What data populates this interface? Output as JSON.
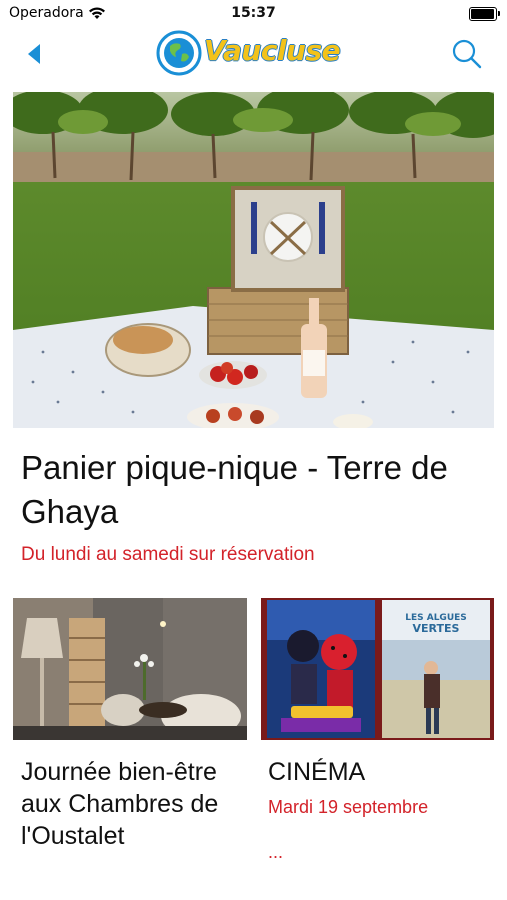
{
  "status_bar": {
    "carrier": "Operadora",
    "time": "15:37",
    "battery_level": 0.9
  },
  "nav": {
    "brand": "Vaucluse",
    "back_icon": "chevron-left-icon",
    "search_icon": "search-icon",
    "accent_color": "#1a8fd6",
    "brand_color": "#f3c21a"
  },
  "featured": {
    "title": "Panier pique-nique - Terre de Ghaya",
    "subtitle": "Du lundi au samedi sur réservation"
  },
  "cards": [
    {
      "title": "Journée bien-être aux Chambres de l'Oustalet",
      "subtitle": "",
      "more": ""
    },
    {
      "title": "CINÉMA",
      "subtitle": "Mardi 19 septembre",
      "more": "..."
    }
  ],
  "posters": [
    {
      "headline": "",
      "kind": "animated-heroes-poster"
    },
    {
      "headline": "LES ALGUES VERTES",
      "kind": "beach-drama-poster"
    }
  ],
  "subtitle_color": "#d3232a"
}
